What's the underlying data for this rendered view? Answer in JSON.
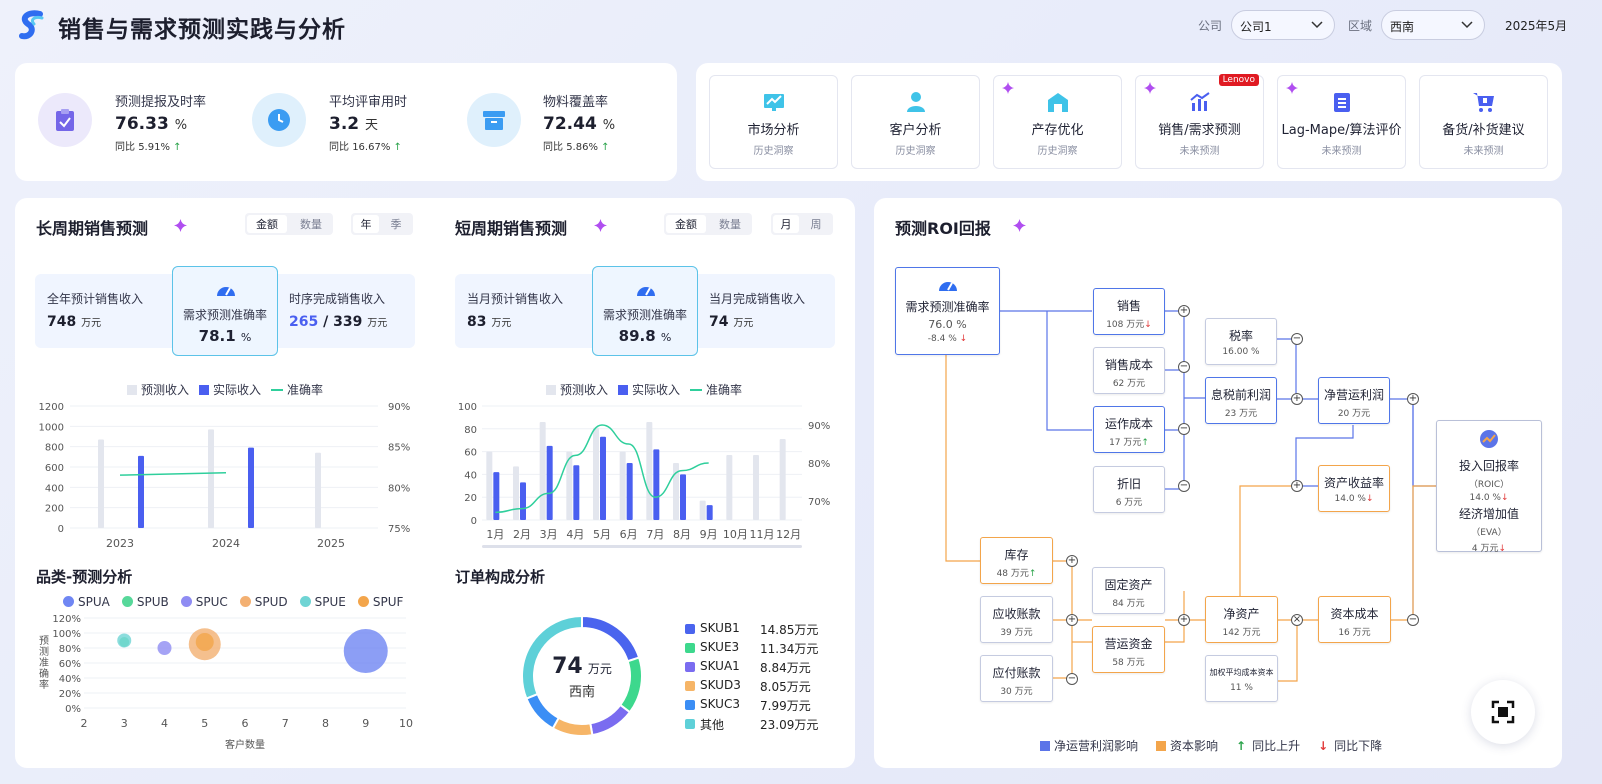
{
  "header": {
    "title": "销售与需求预测实践与分析",
    "company_label": "公司",
    "company_value": "公司1",
    "region_label": "区域",
    "region_value": "西南",
    "date": "2025年5月"
  },
  "kpis": [
    {
      "label": "预测提报及时率",
      "value": "76.33",
      "unit": "%",
      "yoy_label": "同比",
      "yoy": "5.91%",
      "trend": "up",
      "icon": "clipboard-check-icon"
    },
    {
      "label": "平均评审用时",
      "value": "3.2",
      "unit": "天",
      "yoy_label": "同比",
      "yoy": "16.67%",
      "trend": "up",
      "icon": "clock-icon"
    },
    {
      "label": "物料覆盖率",
      "value": "72.44",
      "unit": "%",
      "yoy_label": "同比",
      "yoy": "5.86%",
      "trend": "up",
      "icon": "archive-box-icon"
    }
  ],
  "nav": [
    {
      "title": "市场分析",
      "sub": "历史洞察",
      "icon": "trend-chart-icon"
    },
    {
      "title": "客户分析",
      "sub": "历史洞察",
      "icon": "user-icon"
    },
    {
      "title": "产存优化",
      "sub": "历史洞察",
      "icon": "warehouse-icon"
    },
    {
      "title": "销售/需求预测",
      "sub": "未来预测",
      "icon": "bar-chart-icon",
      "badge": "Lenovo"
    },
    {
      "title": "Lag-Mape/算法评价",
      "sub": "未来预测",
      "icon": "report-icon"
    },
    {
      "title": "备货/补货建议",
      "sub": "未来预测",
      "icon": "cart-icon"
    }
  ],
  "long_term": {
    "title": "长周期销售预测",
    "seg1": [
      "金额",
      "数量"
    ],
    "seg2": [
      "年",
      "季"
    ],
    "stat1_label": "全年预计销售收入",
    "stat1_value": "748",
    "stat1_unit": "万元",
    "acc_label": "需求预测准确率",
    "acc_value": "78.1",
    "acc_unit": "%",
    "stat2_label": "时序完成销售收入",
    "stat2_value_a": "265",
    "stat2_sep": " / ",
    "stat2_value_b": "339",
    "stat2_unit": "万元"
  },
  "short_term": {
    "title": "短周期销售预测",
    "seg1": [
      "金额",
      "数量"
    ],
    "seg2": [
      "月",
      "周"
    ],
    "stat1_label": "当月预计销售收入",
    "stat1_value": "83",
    "stat1_unit": "万元",
    "acc_label": "需求预测准确率",
    "acc_value": "89.8",
    "acc_unit": "%",
    "stat2_label": "当月完成销售收入",
    "stat2_value": "74",
    "stat2_unit": "万元"
  },
  "legend": {
    "forecast": "预测收入",
    "actual": "实际收入",
    "accuracy": "准确率"
  },
  "colors": {
    "forecast": "#e3e6ee",
    "actual": "#4a5ff0",
    "accuracy": "#2fcf9c",
    "accent": "#4a5ff0",
    "orange": "#f3a54b"
  },
  "category": {
    "title": "品类-预测分析",
    "xlabel": "客户数量",
    "ylabel": "预测准确率"
  },
  "order": {
    "title": "订单构成分析",
    "center_value": "74",
    "center_unit": "万元",
    "center_sub": "西南"
  },
  "roi": {
    "title": "预测ROI回报",
    "nodes": {
      "acc": {
        "name": "需求预测准确率",
        "val": "76.0 %",
        "chg": "-8.4 %"
      },
      "sales": {
        "name": "销售",
        "val": "108 万元"
      },
      "cogs": {
        "name": "销售成本",
        "val": "62 万元"
      },
      "opex": {
        "name": "运作成本",
        "val": "17 万元"
      },
      "dep": {
        "name": "折旧",
        "val": "6 万元"
      },
      "tax": {
        "name": "税率",
        "val": "16.00 %"
      },
      "ebit": {
        "name": "息税前利润",
        "val": "23 万元"
      },
      "nopat": {
        "name": "净营运利润",
        "val": "20 万元"
      },
      "roa": {
        "name": "资产收益率",
        "val": "14.0 %"
      },
      "roic1": {
        "name": "投入回报率",
        "sub": "（ROIC）",
        "val": "14.0 %"
      },
      "roic2": {
        "name": "经济增加值",
        "sub": "（EVA）",
        "val": "4 万元"
      },
      "inv": {
        "name": "库存",
        "val": "48 万元"
      },
      "ar": {
        "name": "应收账款",
        "val": "39 万元"
      },
      "ap": {
        "name": "应付账款",
        "val": "30 万元"
      },
      "fa": {
        "name": "固定资产",
        "val": "84 万元"
      },
      "wc": {
        "name": "营运资金",
        "val": "58 万元"
      },
      "na": {
        "name": "净资产",
        "val": "142 万元"
      },
      "cc": {
        "name": "资本成本",
        "val": "16 万元"
      },
      "wacc": {
        "name": "加权平均成本资本",
        "val": "11 %"
      }
    },
    "legend": [
      "净运营利润影响",
      "资本影响",
      "同比上升",
      "同比下降"
    ]
  },
  "chart_data": [
    {
      "type": "bar",
      "name": "long-term",
      "categories": [
        "2023",
        "",
        "2024",
        "",
        "2025"
      ],
      "series": [
        {
          "name": "预测收入",
          "values": [
            870,
            970,
            740
          ]
        },
        {
          "name": "实际收入",
          "values": [
            710,
            790,
            null
          ]
        },
        {
          "name": "准确率",
          "type": "line",
          "values": [
            81.5,
            81.8
          ]
        }
      ],
      "ylim": [
        0,
        1200
      ],
      "y2lim": [
        75,
        90
      ],
      "yticks": [
        "0",
        "200",
        "400",
        "600",
        "800",
        "1000",
        "1200"
      ],
      "y2ticks": [
        "75%",
        "80%",
        "85%",
        "90%"
      ]
    },
    {
      "type": "bar",
      "name": "short-term",
      "categories": [
        "1月",
        "2月",
        "3月",
        "4月",
        "5月",
        "6月",
        "7月",
        "8月",
        "9月",
        "10月",
        "11月",
        "12月"
      ],
      "series": [
        {
          "name": "预测收入",
          "values": [
            60,
            47,
            86,
            60,
            81,
            60,
            86,
            50,
            17,
            57,
            57,
            71
          ]
        },
        {
          "name": "实际收入",
          "values": [
            42,
            33,
            65,
            48,
            73,
            50,
            62,
            40,
            13,
            null,
            null,
            null
          ]
        },
        {
          "name": "准确率",
          "type": "line",
          "values": [
            67,
            68,
            72,
            82,
            90,
            85,
            71,
            78,
            80
          ]
        }
      ],
      "ylim": [
        0,
        100
      ],
      "y2lim": [
        65,
        95
      ],
      "yticks": [
        "0",
        "20",
        "40",
        "60",
        "80",
        "100"
      ],
      "y2ticks": [
        "70%",
        "80%",
        "90%"
      ]
    },
    {
      "type": "scatter",
      "name": "category",
      "series": [
        {
          "name": "SPUA",
          "color": "#6f86f3",
          "x": 9,
          "y": 76,
          "size": 44
        },
        {
          "name": "SPUB",
          "color": "#57d89a",
          "x": 3,
          "y": 88,
          "size": 10
        },
        {
          "name": "SPUC",
          "color": "#8f8cf3",
          "x": 4,
          "y": 80,
          "size": 14
        },
        {
          "name": "SPUD",
          "color": "#f3b072",
          "x": 5,
          "y": 85,
          "size": 32
        },
        {
          "name": "SPUE",
          "color": "#6fd4d4",
          "x": 3,
          "y": 90,
          "size": 14
        },
        {
          "name": "SPUF",
          "color": "#f3a54b",
          "x": 5,
          "y": 88,
          "size": 18
        }
      ],
      "xlim": [
        2,
        10
      ],
      "ylim": [
        0,
        120
      ],
      "xticks": [
        "2",
        "3",
        "4",
        "5",
        "6",
        "7",
        "8",
        "9",
        "10"
      ],
      "yticks": [
        "0%",
        "20%",
        "40%",
        "60%",
        "80%",
        "100%",
        "120%"
      ]
    },
    {
      "type": "pie",
      "name": "order",
      "slices": [
        {
          "name": "SKUB1",
          "value": 14.85,
          "label": "14.85万元",
          "color": "#4a64ee"
        },
        {
          "name": "SKUE3",
          "value": 11.34,
          "label": "11.34万元",
          "color": "#3dd88d"
        },
        {
          "name": "SKUA1",
          "value": 8.84,
          "label": "8.84万元",
          "color": "#7a6cf0"
        },
        {
          "name": "SKUD3",
          "value": 8.05,
          "label": "8.05万元",
          "color": "#f6b567"
        },
        {
          "name": "SKUC3",
          "value": 7.99,
          "label": "7.99万元",
          "color": "#3b8ef5"
        },
        {
          "name": "其他",
          "value": 23.09,
          "label": "23.09万元",
          "color": "#5ed0d8"
        }
      ]
    }
  ]
}
